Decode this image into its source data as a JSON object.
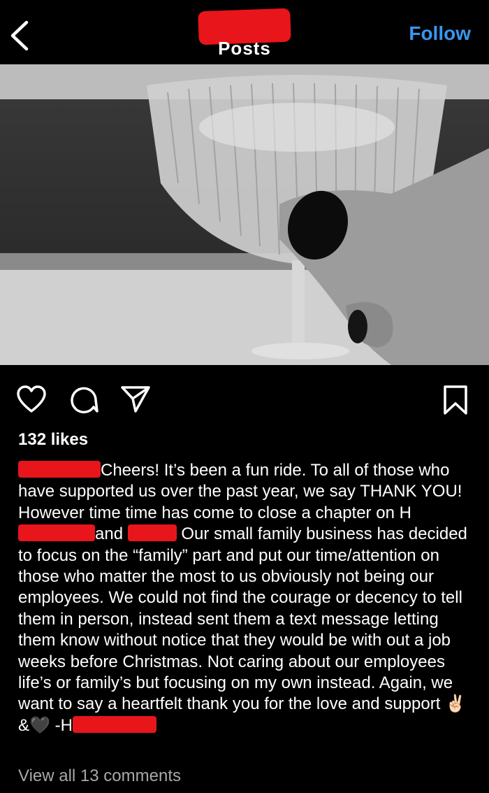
{
  "header": {
    "title": "Posts",
    "follow_label": "Follow",
    "back_icon": "chevron-left-icon"
  },
  "post": {
    "image_icon": "photo-of-cocktail-glass",
    "likes": "132 likes",
    "caption": {
      "part1": "Cheers!  It’s been a fun ride.  To all of those who have supported us over the past year, we say THANK YOU!  However time time has come to close a chapter on H",
      "part2": "and",
      "part3": "Our small family business has decided to focus on the “family” part and put our time/attention on those who matter the most to us obviously not being our employees. We could not find the courage or decency to tell them in person, instead sent them a text message letting them know without notice that they would be with out a job weeks before Christmas. Not caring about our employees life’s or family’s but focusing on my own instead. Again, we want to say a heartfelt thank you for the love and support",
      "emoji_peace": "✌🏻",
      "amp": "&",
      "emoji_heart": "🖤",
      "signoff": "-H"
    },
    "comments_link": "View all 13 comments"
  },
  "colors": {
    "background": "#000000",
    "accent": "#3897f0",
    "redaction": "#e8151a",
    "muted": "#a8a8a8"
  },
  "icons": {
    "like": "heart-icon",
    "comment": "comment-bubble-icon",
    "share": "paper-plane-icon",
    "save": "bookmark-icon"
  }
}
